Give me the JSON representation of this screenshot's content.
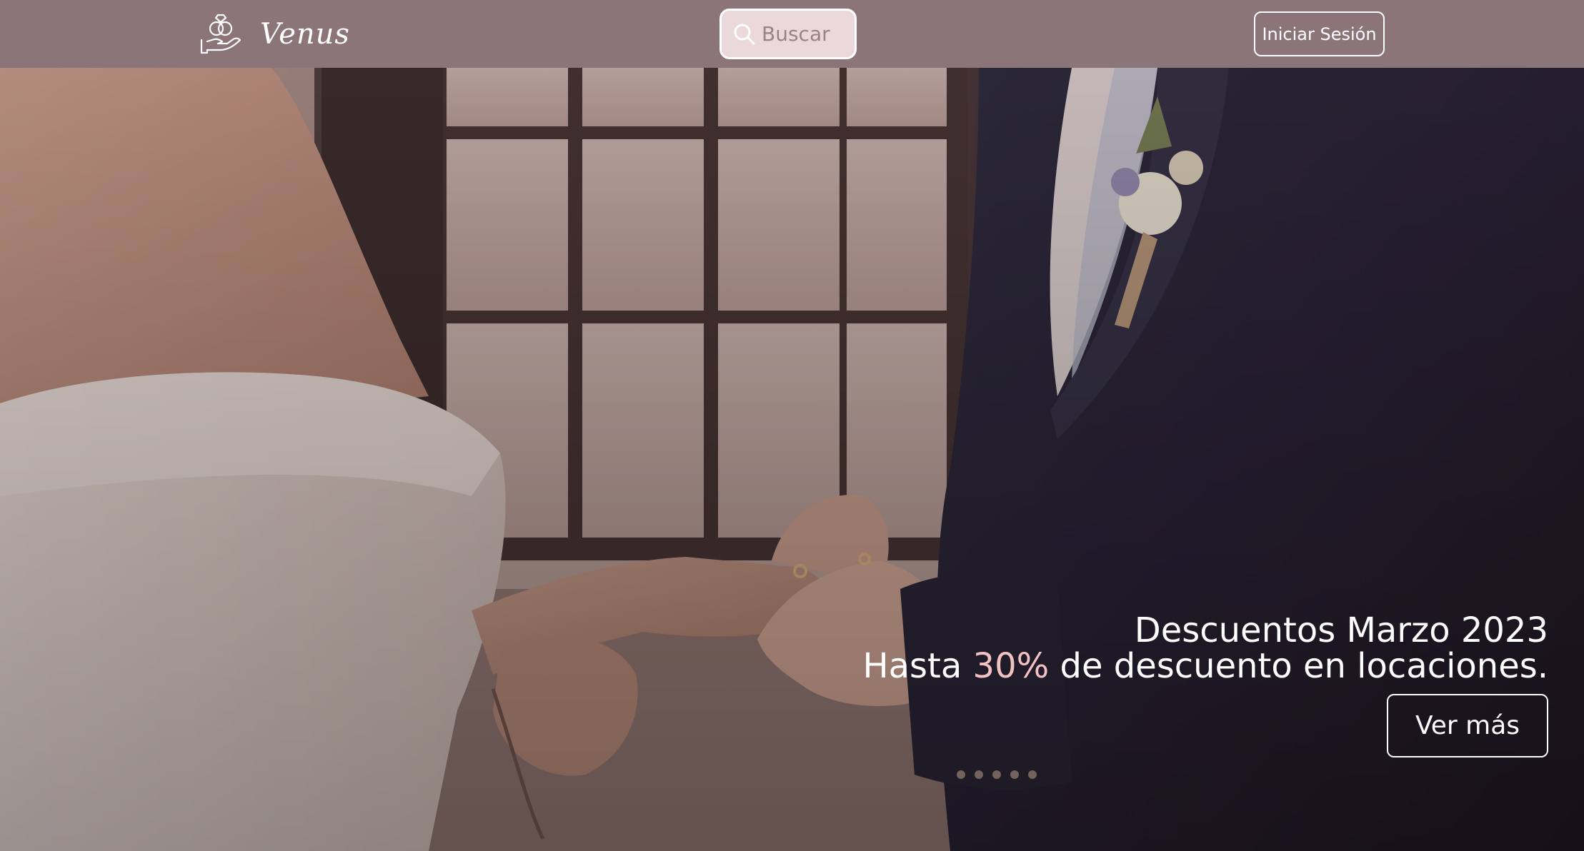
{
  "navbar": {
    "brand": {
      "name": "Venus",
      "logo_icon": "rings-in-hand-icon"
    },
    "search": {
      "placeholder": "Buscar",
      "value": "",
      "icon": "search-icon"
    },
    "login_label": "Iniciar Sesión"
  },
  "hero": {
    "image": "wedding-ring-exchange-photo",
    "promo": {
      "title": "Descuentos Marzo 2023",
      "subtitle_prefix": "Hasta ",
      "subtitle_highlight": "30%",
      "subtitle_suffix": " de descuento en locaciones.",
      "button_label": "Ver más"
    }
  },
  "colors": {
    "navbar_bg": "#8c7579",
    "search_bg": "#ead8db",
    "text_light": "#ffffff",
    "highlight": "#f2c2c2"
  }
}
